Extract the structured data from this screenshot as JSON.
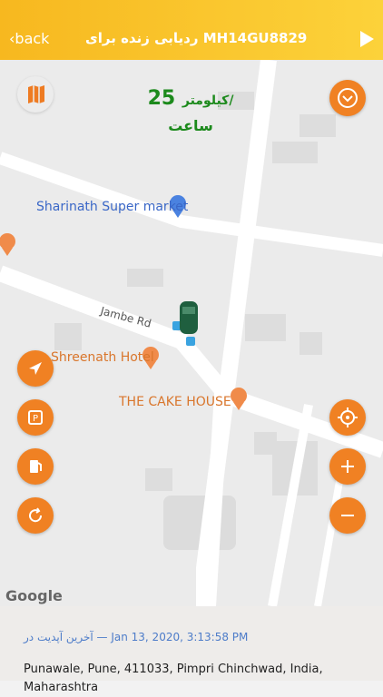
{
  "header": {
    "back_label": "back",
    "title": "ردیابی زنده برای MH14GU8829"
  },
  "speed": {
    "value": "25",
    "unit": "کیلومتر/",
    "per": "ساعت"
  },
  "map": {
    "poi": [
      {
        "label": "Sharinath Super market"
      },
      {
        "label": "Shreenath Hotel"
      },
      {
        "label": "THE CAKE HOUSE"
      }
    ],
    "road_label": "Jambe Rd",
    "attribution": "Google"
  },
  "footer": {
    "last_update": "آخرین آپدیت در — Jan 13, 2020, 3:13:58 PM",
    "address": "Punawale, Pune, 411033, Pimpri Chinchwad, India, Maharashtra"
  },
  "colors": {
    "header": "#f7b81f",
    "accent": "#f08123",
    "speed_text": "#1c8a1c"
  }
}
